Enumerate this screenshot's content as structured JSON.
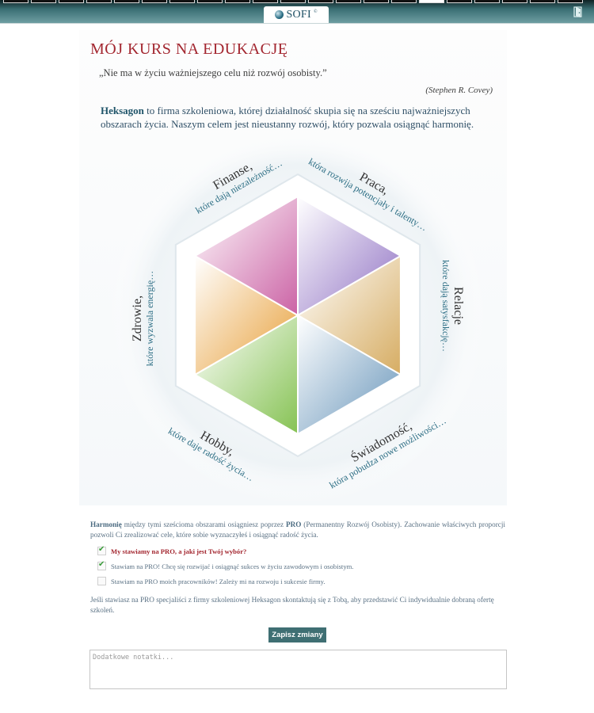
{
  "header": {
    "logo_text": "SOFI",
    "logo_mark": "©",
    "tabs_count": 21,
    "active_tab": 15,
    "exit_icon": "exit-door-icon"
  },
  "page": {
    "title": "MÓJ KURS NA EDUKACJĘ",
    "quote": "„Nie ma w życiu ważniejszego celu niż rozwój osobisty.”",
    "quote_author": "(Stephen R. Covey)",
    "intro_brand": "Heksagon",
    "intro_text": " to firma szkoleniowa, której działalność skupia się na sześciu najważniejszych obszarach życia. Naszym celem jest nieustanny rozwój, który pozwala osiągnąć harmonię."
  },
  "hexagon": {
    "areas": [
      {
        "name": "Finanse,",
        "sub": "które dają niezależność…",
        "color": "#d4a85a"
      },
      {
        "name": "Praca,",
        "sub": "która rozwija potencjały i talenty…",
        "color": "#5f8fb6"
      },
      {
        "name": "Relacje",
        "sub": "które dają satysfakcję…",
        "color": "#7fbf4a"
      },
      {
        "name": "Świadomość,",
        "sub": "która pobudza nowe możliwości…",
        "color": "#e69a2e"
      },
      {
        "name": "Hobby,",
        "sub": "które daje radość życia…",
        "color": "#c85aa0"
      },
      {
        "name": "Zdrowie,",
        "sub": "które wyzwala energię…",
        "color": "#8a6ac0"
      }
    ]
  },
  "form": {
    "description_bold": "Harmonię",
    "description_pre": " między tymi sześcioma obszarami osiągniesz poprzez ",
    "description_pro": "PRO",
    "description_post": " (Permanentny Rozwój Osobisty). Zachowanie właściwych proporcji pozwoli Ci zrealizować cele, które sobie wyznaczyłeś i osiągnąć radość życia.",
    "options": [
      {
        "label": "My stawiamy na PRO, a jaki jest Twój wybór?",
        "checked": true
      },
      {
        "label": "Stawiam na PRO! Chcę się rozwijać i osiągnąć sukces w życiu zawodowym i osobistym.",
        "checked": true
      },
      {
        "label": "Stawiam na PRO moich pracowników! Zależy mi na rozwoju i sukcesie firmy.",
        "checked": false
      }
    ],
    "contact_text": "Jeśli stawiasz na PRO specjaliści z firmy szkoleniowej Heksagon skontaktują się z Tobą, aby przedstawić Ci indywidualnie dobraną ofertę szkoleń.",
    "save_label": "Zapisz zmiany",
    "notes_placeholder": "Dodatkowe notatki..."
  }
}
